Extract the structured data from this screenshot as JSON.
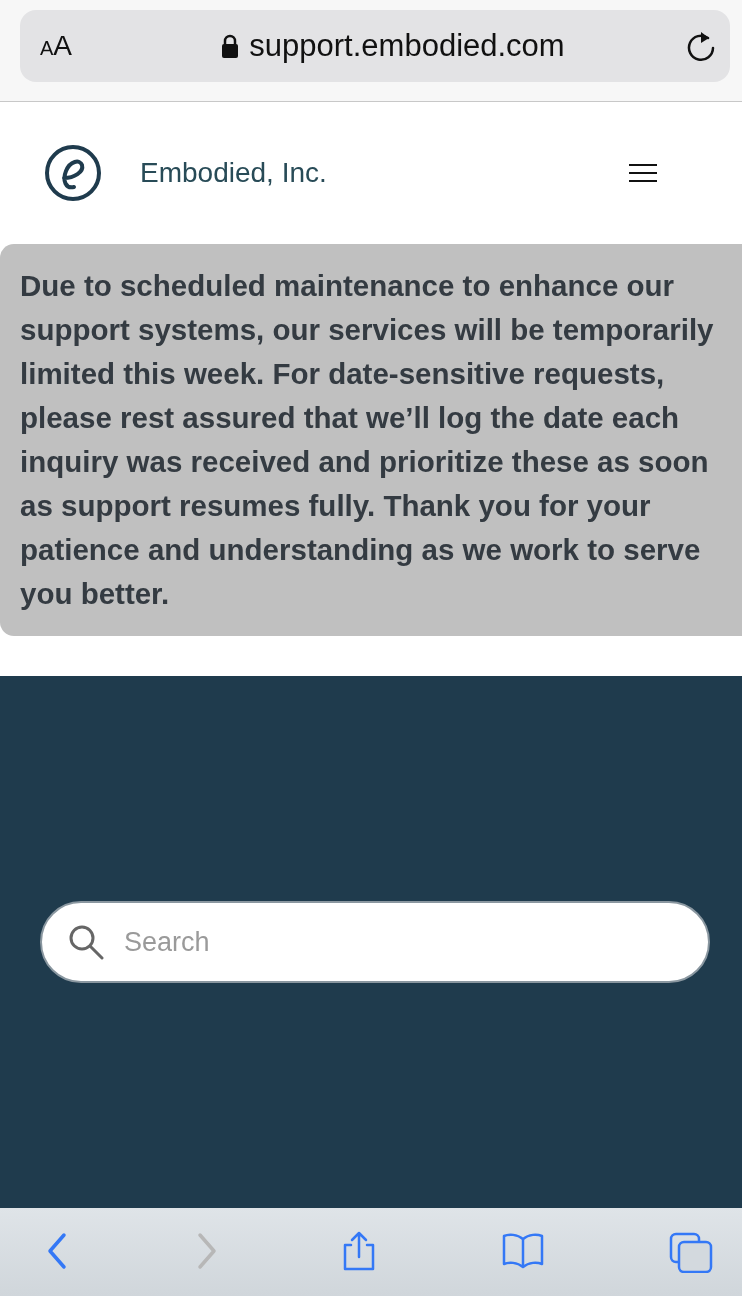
{
  "browser": {
    "text_size_label": "AA",
    "url": "support.embodied.com"
  },
  "site": {
    "name": "Embodied, Inc.",
    "notice": "Due to scheduled maintenance to enhance our support systems, our services will be temporarily limited this week. For date-sensitive requests, please rest assured that we’ll log the date each inquiry was received and prioritize these as soon as support resumes fully. Thank you for your patience and understanding as we work to serve you better.",
    "search": {
      "placeholder": "Search"
    }
  },
  "toolbar": [
    {
      "kind": "back",
      "disabled": false
    },
    {
      "kind": "forward",
      "disabled": true
    },
    {
      "kind": "share",
      "disabled": false
    },
    {
      "kind": "bookmarks",
      "disabled": false
    },
    {
      "kind": "tabs",
      "disabled": false
    }
  ]
}
